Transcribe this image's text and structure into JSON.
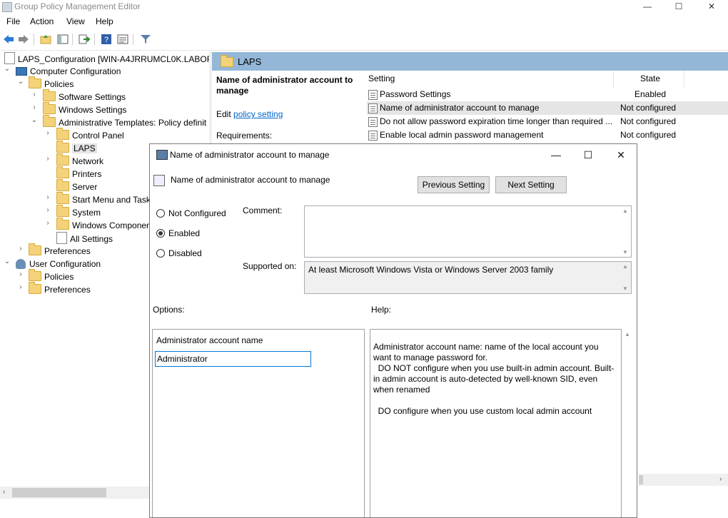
{
  "window": {
    "title": "Group Policy Management Editor",
    "controls": {
      "minimize": "—",
      "maximize": "☐",
      "close": "✕"
    }
  },
  "menu": [
    "File",
    "Action",
    "Help",
    "View"
  ],
  "menu_items": {
    "file": "File",
    "action": "Action",
    "view": "View",
    "help": "Help"
  },
  "tree": {
    "root": "LAPS_Configuration [WIN-A4JRRUMCL0K.LABORA",
    "computer_configuration": "Computer Configuration",
    "policies": "Policies",
    "software_settings": "Software Settings",
    "windows_settings": "Windows Settings",
    "admin_templates": "Administrative Templates: Policy definit",
    "control_panel": "Control Panel",
    "laps": "LAPS",
    "network": "Network",
    "printers": "Printers",
    "server": "Server",
    "start_menu": "Start Menu and Task",
    "system": "System",
    "windows_components": "Windows Componen",
    "all_settings": "All Settings",
    "preferences": "Preferences",
    "user_configuration": "User Configuration",
    "user_policies": "Policies",
    "user_preferences": "Preferences"
  },
  "details": {
    "folder": "LAPS",
    "selected_title": "Name of administrator account to manage",
    "edit_prefix": "Edit ",
    "edit_link": "policy setting ",
    "requirements": "Requirements:",
    "col_setting": "Setting",
    "col_state": "State",
    "rows": [
      {
        "name": "Password Settings",
        "state": "Enabled"
      },
      {
        "name": "Name of administrator account to manage",
        "state": "Not configured"
      },
      {
        "name": "Do not allow password expiration time longer than required ...",
        "state": "Not configured"
      },
      {
        "name": "Enable local admin password management",
        "state": "Not configured"
      }
    ]
  },
  "dialog": {
    "title": "Name of administrator account to manage",
    "heading": "Name of administrator account to manage",
    "prev_button": "Previous Setting",
    "next_button": "Next Setting",
    "options": {
      "not_configured": "Not Configured",
      "enabled": "Enabled",
      "disabled": "Disabled"
    },
    "selected_option": "Enabled",
    "comment_label": "Comment:",
    "comment_value": "",
    "supported_label": "Supported on:",
    "supported_value": "At least Microsoft Windows Vista or Windows Server 2003 family",
    "options_label": "Options:",
    "help_label": "Help:",
    "field_label": "Administrator account name",
    "field_value": "Administrator",
    "help_text": "Administrator account name: name of the local account you want to manage password for.\n  DO NOT configure when you use built-in admin account. Built-in admin account is auto-detected by well-known SID, even when renamed\n\n  DO configure when you use custom local admin account"
  },
  "colors": {
    "header_blue": "#94b7d8",
    "link": "#0066cc",
    "selection": "#e5e5e5"
  }
}
